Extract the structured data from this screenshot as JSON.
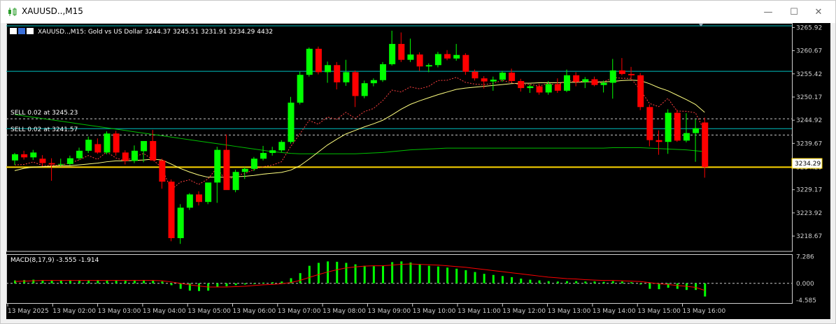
{
  "window": {
    "title": "XAUUSD..,M15",
    "minimize_icon": "minimize-icon",
    "maximize_icon": "maximize-icon",
    "close_icon": "close-icon"
  },
  "chart_header": {
    "symbol_info": "XAUUSD..,M15:  Gold vs US Dollar  3244.37 3245.51 3231.91 3234.29  4432"
  },
  "trade_lines": [
    {
      "label": "SELL 0.02 at 3245.23",
      "price": 3245.23
    },
    {
      "label": "SELL 0.02 at 3241.57",
      "price": 3241.57
    }
  ],
  "current_price": {
    "label": "3234.29",
    "value": 3234.29
  },
  "colors": {
    "bull": "#00ff00",
    "bear": "#ff0000",
    "bid": "#ffd700",
    "ma_green": "#00c000",
    "ma_yellow": "#ffff80",
    "ma_red": "#ff4040",
    "level": "#00c0c0"
  },
  "chart_data": {
    "type": "candlestick",
    "price_axis_ticks": [
      "3265.92",
      "3260.67",
      "3255.42",
      "3250.17",
      "3244.92",
      "3239.67",
      "3234.29",
      "3229.17",
      "3223.92",
      "3218.67"
    ],
    "time_axis_ticks": [
      "13 May 2025",
      "13 May 02:00",
      "13 May 03:00",
      "13 May 04:00",
      "13 May 05:00",
      "13 May 06:00",
      "13 May 07:00",
      "13 May 08:00",
      "13 May 09:00",
      "13 May 10:00",
      "13 May 11:00",
      "13 May 12:00",
      "13 May 13:00",
      "13 May 14:00",
      "13 May 15:00",
      "13 May 16:00"
    ],
    "ylim": [
      3215.2,
      3266.3
    ],
    "candles": [
      [
        3235.8,
        3237.5,
        3234.8,
        3237.2
      ],
      [
        3237.2,
        3238.0,
        3236.0,
        3236.5
      ],
      [
        3236.5,
        3238.2,
        3235.9,
        3237.6
      ],
      [
        3236.2,
        3237.0,
        3234.5,
        3235.2
      ],
      [
        3235.2,
        3236.3,
        3231.2,
        3234.9
      ],
      [
        3234.9,
        3236.2,
        3234.4,
        3235.0
      ],
      [
        3235.0,
        3236.9,
        3234.7,
        3236.3
      ],
      [
        3236.3,
        3238.7,
        3235.9,
        3238.0
      ],
      [
        3238.0,
        3241.2,
        3237.5,
        3240.5
      ],
      [
        3239.5,
        3240.8,
        3237.3,
        3237.6
      ],
      [
        3237.6,
        3242.4,
        3237.2,
        3241.9
      ],
      [
        3241.9,
        3242.5,
        3236.9,
        3237.6
      ],
      [
        3237.6,
        3238.1,
        3234.9,
        3235.7
      ],
      [
        3235.7,
        3239.2,
        3235.2,
        3238.0
      ],
      [
        3237.9,
        3240.2,
        3235.4,
        3240.2
      ],
      [
        3240.2,
        3242.7,
        3236.4,
        3235.8
      ],
      [
        3235.8,
        3236.2,
        3229.4,
        3231.0
      ],
      [
        3231.0,
        3231.5,
        3217.5,
        3218.2
      ],
      [
        3218.2,
        3225.9,
        3216.9,
        3225.1
      ],
      [
        3225.1,
        3228.4,
        3224.6,
        3228.1
      ],
      [
        3228.1,
        3228.8,
        3225.6,
        3226.4
      ],
      [
        3226.4,
        3229.4,
        3225.9,
        3230.8
      ],
      [
        3230.8,
        3238.9,
        3226.2,
        3238.2
      ],
      [
        3238.2,
        3241.7,
        3229.4,
        3229.1
      ],
      [
        3229.1,
        3233.7,
        3228.6,
        3233.2
      ],
      [
        3233.2,
        3234.3,
        3231.6,
        3233.9
      ],
      [
        3233.9,
        3236.6,
        3233.4,
        3236.2
      ],
      [
        3236.2,
        3239.1,
        3235.8,
        3237.5
      ],
      [
        3237.5,
        3238.9,
        3236.9,
        3238.1
      ],
      [
        3238.1,
        3240.4,
        3237.7,
        3240.0
      ],
      [
        3240.0,
        3250.2,
        3239.6,
        3248.9
      ],
      [
        3248.9,
        3255.9,
        3248.5,
        3255.2
      ],
      [
        3255.2,
        3261.4,
        3254.8,
        3261.1
      ],
      [
        3261.1,
        3261.6,
        3255.3,
        3255.8
      ],
      [
        3255.8,
        3258.2,
        3253.4,
        3257.4
      ],
      [
        3257.4,
        3258.1,
        3251.9,
        3253.5
      ],
      [
        3253.5,
        3258.6,
        3252.7,
        3255.8
      ],
      [
        3255.8,
        3256.2,
        3247.9,
        3250.4
      ],
      [
        3250.4,
        3253.9,
        3249.9,
        3253.3
      ],
      [
        3253.3,
        3254.4,
        3252.6,
        3254.0
      ],
      [
        3254.0,
        3258.1,
        3253.6,
        3257.6
      ],
      [
        3257.6,
        3265.2,
        3257.3,
        3262.2
      ],
      [
        3262.2,
        3264.8,
        3258.1,
        3258.6
      ],
      [
        3258.6,
        3263.4,
        3258.1,
        3259.8
      ],
      [
        3259.8,
        3260.3,
        3256.1,
        3257.1
      ],
      [
        3257.1,
        3257.8,
        3255.8,
        3257.4
      ],
      [
        3257.4,
        3260.4,
        3256.9,
        3259.9
      ],
      [
        3259.9,
        3260.8,
        3258.5,
        3258.9
      ],
      [
        3258.9,
        3262.2,
        3258.4,
        3259.7
      ],
      [
        3259.7,
        3260.1,
        3255.2,
        3255.9
      ],
      [
        3255.9,
        3256.4,
        3253.9,
        3254.4
      ],
      [
        3254.4,
        3254.9,
        3252.1,
        3253.7
      ],
      [
        3253.7,
        3254.8,
        3251.6,
        3254.1
      ],
      [
        3254.1,
        3256.1,
        3253.6,
        3255.7
      ],
      [
        3255.7,
        3256.6,
        3253.4,
        3253.8
      ],
      [
        3253.8,
        3254.3,
        3251.4,
        3252.2
      ],
      [
        3252.2,
        3253.1,
        3251.1,
        3252.6
      ],
      [
        3252.6,
        3253.2,
        3250.7,
        3251.2
      ],
      [
        3251.2,
        3253.8,
        3250.7,
        3253.1
      ],
      [
        3253.1,
        3254.4,
        3251.1,
        3251.6
      ],
      [
        3251.6,
        3256.4,
        3251.3,
        3255.1
      ],
      [
        3255.1,
        3255.8,
        3252.6,
        3253.6
      ],
      [
        3253.6,
        3254.7,
        3252.2,
        3254.2
      ],
      [
        3254.2,
        3254.8,
        3252.6,
        3252.9
      ],
      [
        3252.9,
        3253.9,
        3251.2,
        3253.4
      ],
      [
        3253.4,
        3258.8,
        3249.8,
        3256.2
      ],
      [
        3256.2,
        3259.0,
        3255.1,
        3255.4
      ],
      [
        3255.4,
        3257.0,
        3254.2,
        3255.1
      ],
      [
        3255.1,
        3255.6,
        3247.2,
        3247.9
      ],
      [
        3247.9,
        3248.5,
        3239.0,
        3240.4
      ],
      [
        3240.4,
        3242.6,
        3237.1,
        3240.0
      ],
      [
        3240.0,
        3247.4,
        3237.3,
        3246.6
      ],
      [
        3246.6,
        3247.3,
        3240.0,
        3240.3
      ],
      [
        3240.3,
        3246.5,
        3239.9,
        3242.0
      ],
      [
        3242.0,
        3245.1,
        3235.5,
        3243.1
      ],
      [
        3244.4,
        3245.5,
        3231.9,
        3234.3
      ]
    ],
    "ma_yellow": [
      3233.5,
      3234.0,
      3234.3,
      3234.4,
      3234.5,
      3234.6,
      3234.6,
      3234.8,
      3235.0,
      3235.2,
      3235.5,
      3235.7,
      3235.7,
      3235.8,
      3235.9,
      3236.1,
      3235.9,
      3235.0,
      3234.0,
      3233.2,
      3232.5,
      3232.0,
      3232.0,
      3232.0,
      3232.1,
      3232.2,
      3232.4,
      3232.7,
      3232.9,
      3233.1,
      3233.6,
      3234.6,
      3236.1,
      3237.7,
      3239.3,
      3240.6,
      3241.8,
      3242.6,
      3243.4,
      3244.1,
      3244.9,
      3246.1,
      3247.4,
      3248.5,
      3249.3,
      3250.0,
      3250.7,
      3251.3,
      3251.9,
      3252.2,
      3252.4,
      3252.6,
      3252.8,
      3253.0,
      3253.2,
      3253.3,
      3253.3,
      3253.4,
      3253.4,
      3253.4,
      3253.5,
      3253.5,
      3253.6,
      3253.6,
      3253.6,
      3253.7,
      3253.9,
      3254.0,
      3253.9,
      3253.2,
      3252.3,
      3251.6,
      3250.6,
      3249.6,
      3248.5,
      3246.7
    ],
    "ma_green": [
      3246.2,
      3245.9,
      3245.6,
      3245.3,
      3245.0,
      3244.7,
      3244.4,
      3244.1,
      3243.8,
      3243.5,
      3243.2,
      3242.9,
      3242.6,
      3242.3,
      3242.0,
      3241.7,
      3241.4,
      3241.1,
      3240.8,
      3240.5,
      3240.2,
      3239.9,
      3239.6,
      3239.3,
      3239.0,
      3238.7,
      3238.4,
      3238.1,
      3237.8,
      3237.6,
      3237.4,
      3237.3,
      3237.3,
      3237.3,
      3237.3,
      3237.3,
      3237.3,
      3237.3,
      3237.4,
      3237.5,
      3237.6,
      3237.8,
      3238.0,
      3238.2,
      3238.3,
      3238.4,
      3238.5,
      3238.6,
      3238.6,
      3238.6,
      3238.6,
      3238.6,
      3238.6,
      3238.6,
      3238.6,
      3238.6,
      3238.6,
      3238.6,
      3238.6,
      3238.6,
      3238.6,
      3238.6,
      3238.6,
      3238.6,
      3238.6,
      3238.7,
      3238.7,
      3238.7,
      3238.7,
      3238.6,
      3238.5,
      3238.4,
      3238.3,
      3238.2,
      3238.0,
      3237.8
    ],
    "macd": {
      "label": "MACD(8,17,9) -3.555 -1.914",
      "ticks": [
        "7.286",
        "0.000",
        "-4.585"
      ],
      "ylim": [
        -5.2,
        7.6
      ],
      "hist": [
        0.8,
        0.9,
        1.0,
        0.9,
        0.8,
        0.8,
        0.8,
        0.8,
        0.9,
        0.9,
        0.9,
        0.8,
        0.7,
        0.8,
        0.9,
        0.8,
        0.5,
        -0.5,
        -1.5,
        -2.0,
        -2.1,
        -2.0,
        -1.0,
        -0.8,
        -0.5,
        -0.3,
        0.0,
        0.2,
        0.3,
        0.5,
        1.4,
        2.8,
        4.8,
        5.6,
        6.0,
        5.9,
        5.6,
        5.2,
        4.8,
        4.7,
        4.8,
        5.8,
        6.0,
        5.7,
        5.2,
        4.8,
        4.6,
        4.3,
        4.0,
        3.6,
        3.1,
        2.6,
        2.3,
        2.0,
        1.7,
        1.3,
        1.0,
        0.8,
        0.6,
        0.5,
        0.6,
        0.6,
        0.5,
        0.5,
        0.4,
        0.6,
        0.5,
        0.3,
        -0.3,
        -1.5,
        -1.6,
        -1.2,
        -1.5,
        -1.8,
        -1.8,
        -3.6
      ],
      "signal": [
        0.5,
        0.6,
        0.7,
        0.8,
        0.8,
        0.8,
        0.8,
        0.8,
        0.8,
        0.8,
        0.8,
        0.8,
        0.8,
        0.8,
        0.8,
        0.8,
        0.7,
        0.4,
        0.0,
        -0.4,
        -0.7,
        -1.0,
        -1.0,
        -1.0,
        -0.9,
        -0.8,
        -0.6,
        -0.4,
        -0.3,
        -0.1,
        0.2,
        0.8,
        1.6,
        2.4,
        3.1,
        3.7,
        4.2,
        4.5,
        4.7,
        4.8,
        4.8,
        5.0,
        5.2,
        5.3,
        5.2,
        5.1,
        5.0,
        4.8,
        4.6,
        4.4,
        4.1,
        3.8,
        3.5,
        3.2,
        2.9,
        2.6,
        2.3,
        2.0,
        1.7,
        1.5,
        1.3,
        1.2,
        1.0,
        0.9,
        0.8,
        0.8,
        0.7,
        0.6,
        0.5,
        0.2,
        -0.1,
        -0.3,
        -0.6,
        -0.8,
        -1.1,
        -1.9
      ]
    }
  }
}
